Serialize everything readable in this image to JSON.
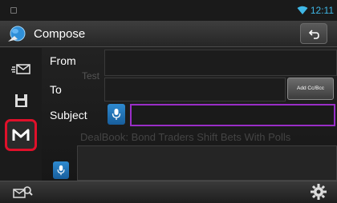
{
  "status_bar": {
    "time": "12:11"
  },
  "header": {
    "title": "Compose"
  },
  "form": {
    "from_label": "From",
    "to_label": "To",
    "subject_label": "Subject",
    "add_cc_bcc_label": "Add Cc/Bcc",
    "ghost_from": "Test",
    "ghost_subject": "DealBook: Bond Traders Shift Bets With Polls"
  },
  "sidebar": {
    "items": [
      {
        "icon": "mail-icon"
      },
      {
        "icon": "save-icon"
      },
      {
        "icon": "trash-icon"
      },
      {
        "icon": "gmail-icon",
        "highlighted": true
      }
    ]
  },
  "colors": {
    "accent": "#3fb7e6",
    "highlight": "#e0102a",
    "subject_border": "#9a2ec8",
    "mic": "#2e8ad0"
  }
}
